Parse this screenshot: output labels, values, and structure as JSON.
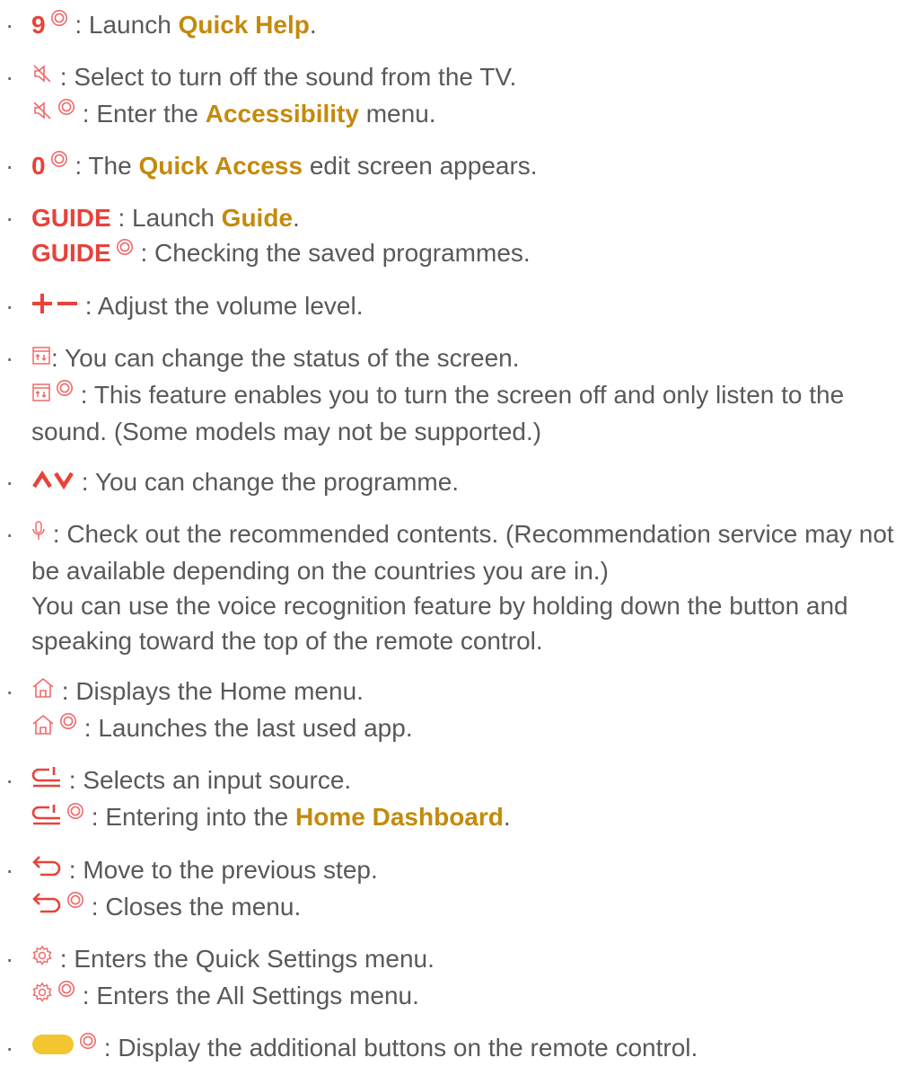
{
  "bullet": "·",
  "colors": {
    "text": "#595959",
    "key_red": "#e8423a",
    "link_gold": "#c48a0b",
    "icon_stroke": "#ef6b6b",
    "yellow": "#f2c531"
  },
  "items": [
    {
      "icon": "number-9",
      "key": "9",
      "hold_icon": "long-press-icon",
      "sep": " : Launch ",
      "link": "Quick Help",
      "end": "."
    },
    {
      "icon": "mute-icon",
      "l1": " : Select to turn off the sound from the TV.",
      "l2_a": " : Enter the ",
      "l2_link": "Accessibility",
      "l2_b": " menu."
    },
    {
      "icon": "number-0",
      "key": "0",
      "sep": " : The ",
      "link": "Quick Access",
      "end": " edit screen appears."
    },
    {
      "key": "GUIDE",
      "l1_a": " : Launch ",
      "l1_link": "Guide",
      "l1_end": ".",
      "l2": " : Checking the saved programmes."
    },
    {
      "icon": "volume-plus-minus-icon",
      "text": " : Adjust the volume level."
    },
    {
      "icon": "screen-mode-icon",
      "l1": ": You can change the status of the screen.",
      "l2": " : This feature enables you to turn the screen off and only listen to the sound. (Some models may not be supported.)"
    },
    {
      "icon": "channel-up-down-icon",
      "text": " : You can change the programme."
    },
    {
      "icon": "microphone-icon",
      "p1": " : Check out the recommended contents. (Recommendation service may not be available depending on the countries you are in.)",
      "p2": "You can use the voice recognition feature by holding down the button and speaking toward the top of the remote control."
    },
    {
      "icon": "home-icon",
      "l1": " : Displays the Home menu.",
      "l2": " : Launches the last used app."
    },
    {
      "icon": "input-source-icon",
      "l1": " : Selects an input source.",
      "l2_a": " : Entering into the ",
      "l2_link": "Home Dashboard",
      "l2_end": "."
    },
    {
      "icon": "back-arrow-icon",
      "l1": " : Move to the previous step.",
      "l2": " : Closes the menu."
    },
    {
      "icon": "settings-gear-icon",
      "l1": " : Enters the Quick Settings menu.",
      "l2": " : Enters the All Settings menu."
    },
    {
      "icon": "yellow-button-icon",
      "text": " : Display the additional buttons on the remote control."
    }
  ]
}
